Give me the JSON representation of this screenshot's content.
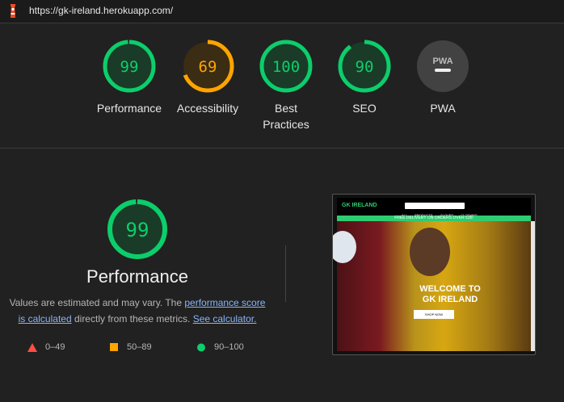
{
  "topbar": {
    "url": "https://gk-ireland.herokuapp.com/"
  },
  "categories": [
    {
      "label": "Performance",
      "score": "99",
      "fraction": 0.99,
      "status": "pass"
    },
    {
      "label": "Accessibility",
      "score": "69",
      "fraction": 0.69,
      "status": "average"
    },
    {
      "label": "Best Practices",
      "score": "100",
      "fraction": 1.0,
      "status": "pass"
    },
    {
      "label": "SEO",
      "score": "90",
      "fraction": 0.9,
      "status": "pass"
    },
    {
      "label": "PWA",
      "score": "",
      "fraction": 0,
      "status": "na"
    }
  ],
  "pwa_badge_text": "PWA",
  "colors": {
    "pass": "#0cce6b",
    "average": "#ffa400",
    "fail": "#ff4e42",
    "na": "#5f5f5f"
  },
  "detail": {
    "score": "99",
    "fraction": 0.99,
    "title": "Performance",
    "desc_prefix": "Values are estimated and may vary. The ",
    "link1": "performance score is calculated",
    "desc_mid": " directly from these metrics. ",
    "link2": "See calculator."
  },
  "legend": [
    {
      "range": "0–49",
      "shape": "triangle-icon",
      "color": "#ff4e42"
    },
    {
      "range": "50–89",
      "shape": "square-icon",
      "color": "#ffa400"
    },
    {
      "range": "90–100",
      "shape": "circle-icon",
      "color": "#0cce6b"
    }
  ],
  "screenshot": {
    "logo": "GK IRELAND",
    "nav": "ALL PRODUCTS GLOVES CLOTHING",
    "banner": "FREE DELIVERY ON ORDERS OVER €35!",
    "heading_1": "WELCOME TO",
    "heading_2": "GK IRELAND",
    "button": "SHOP NOW"
  }
}
